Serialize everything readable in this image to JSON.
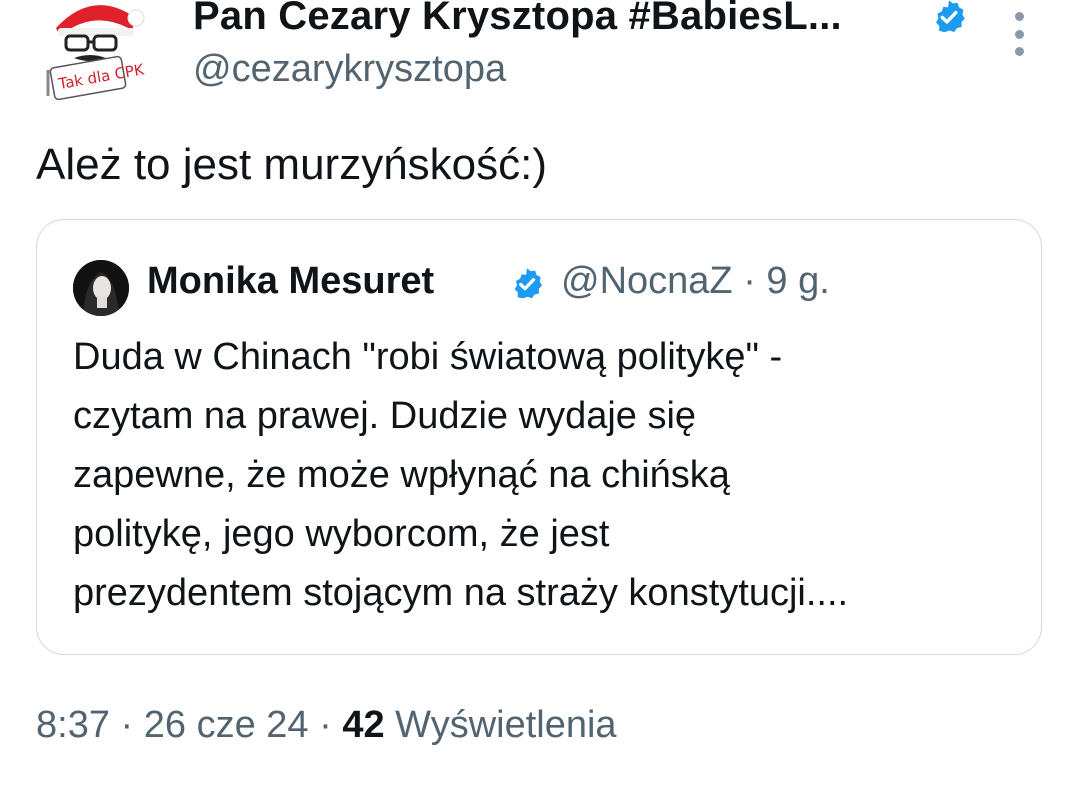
{
  "author": {
    "display_name": "Pan Cezary Krysztopa #BabiesL...",
    "handle": "@cezarykrysztopa",
    "avatar_text": "Tak dla CPK"
  },
  "tweet": {
    "text": "Ależ to jest murzyńskość:)"
  },
  "quoted": {
    "display_name": "Monika Mesuret",
    "handle": "@NocnaZ",
    "separator": "·",
    "time": "9 g.",
    "lines": [
      "Duda w Chinach \"robi światową politykę\" -",
      "czytam na prawej. Dudzie wydaje się",
      "zapewne, że może wpłynąć na chińską",
      "politykę, jego wyborcom, że jest",
      "prezydentem stojącym na straży konstytucji...."
    ]
  },
  "footer": {
    "time": "8:37",
    "date": "26 cze 24",
    "separator": "·",
    "views_count": "42",
    "views_label": "Wyświetlenia"
  },
  "colors": {
    "verified": "#1d9bf0",
    "secondary_text": "#536471",
    "primary_text": "#0f1419",
    "border": "#cfd9de"
  },
  "icons": {
    "verified": "verified-badge-icon",
    "more": "more-vertical-icon"
  }
}
